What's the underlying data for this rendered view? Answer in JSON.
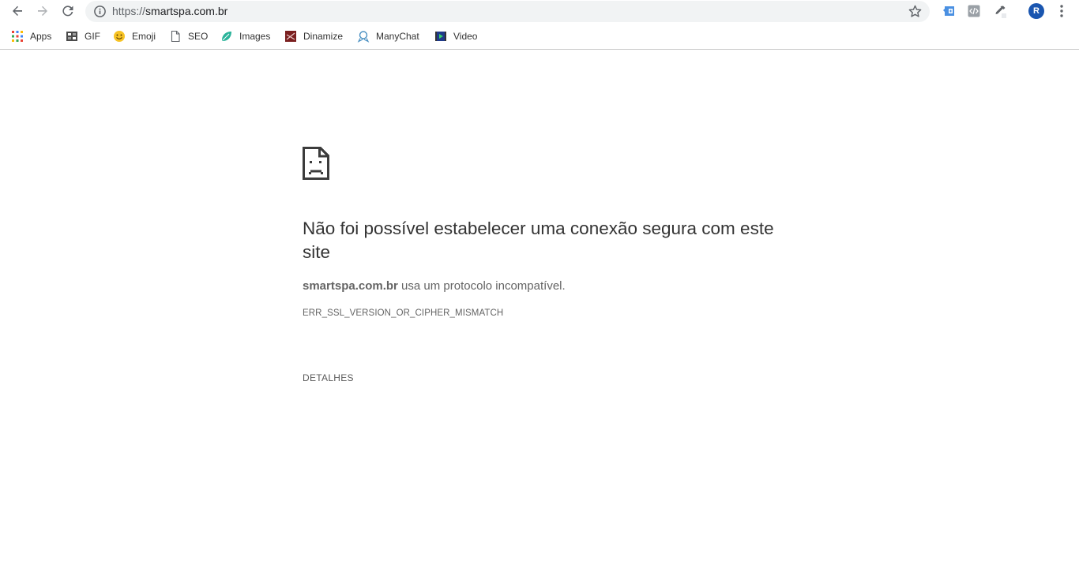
{
  "browser": {
    "address_bar": {
      "scheme": "https://",
      "host": "smartspa.com.br"
    },
    "avatar_initial": "R",
    "accent_color": "#1a56b0"
  },
  "bookmarks": [
    {
      "label": "Apps",
      "icon": "apps-grid-icon"
    },
    {
      "label": "GIF",
      "icon": "gif-icon"
    },
    {
      "label": "Emoji",
      "icon": "emoji-icon"
    },
    {
      "label": "SEO",
      "icon": "page-icon"
    },
    {
      "label": "Images",
      "icon": "images-leaf-icon"
    },
    {
      "label": "Dinamize",
      "icon": "dinamize-icon"
    },
    {
      "label": "ManyChat",
      "icon": "manychat-icon"
    },
    {
      "label": "Video",
      "icon": "video-icon"
    }
  ],
  "error_page": {
    "heading": "Não foi possível estabelecer uma conexão segura com este site",
    "summary_host": "smartspa.com.br",
    "summary_text": " usa um protocolo incompatível.",
    "error_code": "ERR_SSL_VERSION_OR_CIPHER_MISMATCH",
    "details_label": "DETALHES",
    "icon": "sad-page-icon"
  }
}
